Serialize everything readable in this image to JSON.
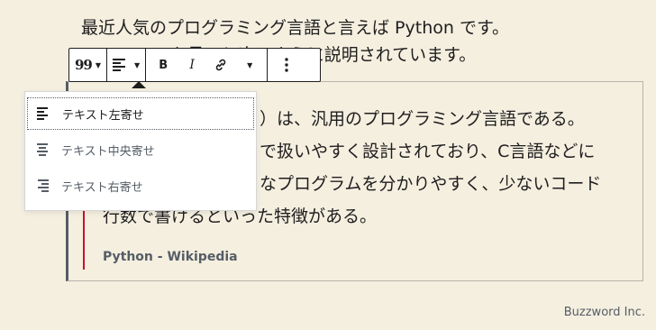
{
  "paragraph": {
    "line1": "最近人気のプログラミング言語と言えば Python です。",
    "line2": "Wikipedia を見ると次のように説明されています。"
  },
  "quote": {
    "line1": "）は、汎用のプログラミング言語である。",
    "line2": "で扱いやすく設計されており、C言語などに",
    "line3": "なプログラムを分かりやすく、少ないコード",
    "line4": "行数で書けるといった特徴がある。",
    "citation": "Python - Wikipedia",
    "accent_color": "#c8102e"
  },
  "toolbar": {
    "block_type_icon": "quote-icon",
    "block_type_glyph": "99",
    "align_icon": "align-left-icon",
    "bold_label": "B",
    "italic_label": "I",
    "link_icon": "link-icon",
    "more_icon": "more-vertical-icon"
  },
  "align_menu": {
    "items": [
      {
        "label": "テキスト左寄せ",
        "icon": "align-left-icon",
        "active": true
      },
      {
        "label": "テキスト中央寄せ",
        "icon": "align-center-icon",
        "active": false
      },
      {
        "label": "テキスト右寄せ",
        "icon": "align-right-icon",
        "active": false
      }
    ]
  },
  "watermark": "Buzzword Inc."
}
